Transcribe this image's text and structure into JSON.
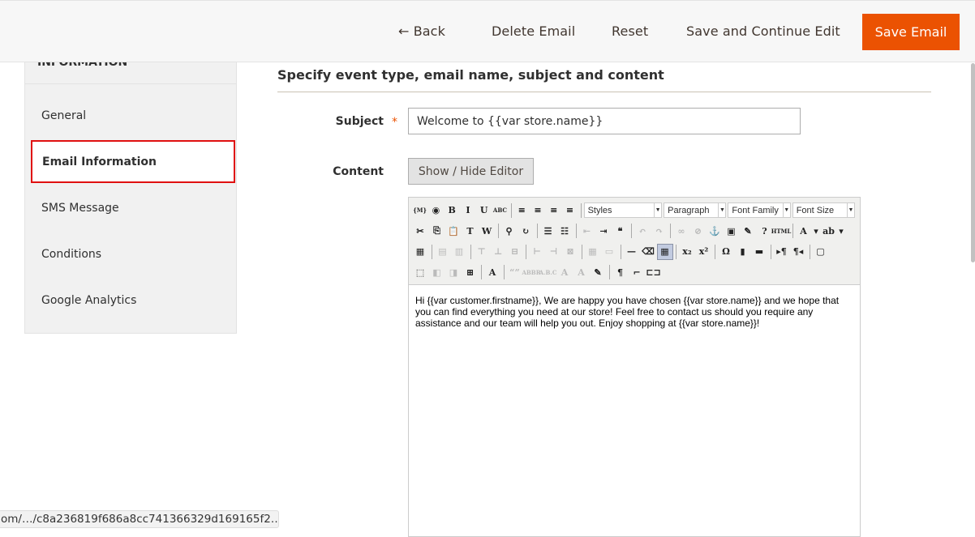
{
  "header": {
    "back": "← Back",
    "delete": "Delete Email",
    "reset": "Reset",
    "save_continue": "Save and Continue Edit",
    "save": "Save Email",
    "accent": "#eb5202"
  },
  "sidebar": {
    "title": "INFORMATION",
    "items": [
      {
        "label": "General"
      },
      {
        "label": "Email Information",
        "active": true
      },
      {
        "label": "SMS Message"
      },
      {
        "label": "Conditions"
      },
      {
        "label": "Google Analytics"
      }
    ]
  },
  "main": {
    "section_title": "Specify event type, email name, subject and content",
    "subject_label": "Subject",
    "required_mark": "*",
    "subject_value": "Welcome to {{var store.name}}",
    "content_label": "Content",
    "toggle_editor": "Show / Hide Editor",
    "editor": {
      "selects": {
        "styles": "Styles",
        "paragraph": "Paragraph",
        "font_family": "Font Family",
        "font_size": "Font Size"
      },
      "rows": [
        [
          [
            "magento-widget-icon",
            "{M}"
          ],
          [
            "magento-variable-icon",
            "◉"
          ],
          [
            "bold-icon",
            "B"
          ],
          [
            "italic-icon",
            "I"
          ],
          [
            "underline-icon",
            "U"
          ],
          [
            "strikethrough-icon",
            "ABC"
          ],
          "|",
          [
            "align-left-icon",
            "≡"
          ],
          [
            "align-center-icon",
            "≡"
          ],
          [
            "align-right-icon",
            "≡"
          ],
          [
            "align-justify-icon",
            "≡"
          ],
          "|",
          "SELECTS"
        ],
        [
          [
            "cut-icon",
            "✂"
          ],
          [
            "copy-icon",
            "⎘"
          ],
          [
            "paste-icon",
            "📋"
          ],
          [
            "paste-text-icon",
            "T"
          ],
          [
            "paste-word-icon",
            "W"
          ],
          "|",
          [
            "find-icon",
            "⚲"
          ],
          [
            "replace-icon",
            "↻"
          ],
          "|",
          [
            "bullet-list-icon",
            "☰"
          ],
          [
            "numbered-list-icon",
            "☷"
          ],
          "|",
          [
            "outdent-icon",
            "⇤",
            1
          ],
          [
            "indent-icon",
            "⇥"
          ],
          [
            "blockquote-icon",
            "❝"
          ],
          "|",
          [
            "undo-icon",
            "↶",
            1
          ],
          [
            "redo-icon",
            "↷",
            1
          ],
          "|",
          [
            "link-icon",
            "∞",
            1
          ],
          [
            "unlink-icon",
            "⊘",
            1
          ],
          [
            "anchor-icon",
            "⚓"
          ],
          [
            "image-icon",
            "▣"
          ],
          [
            "cleanup-icon",
            "✎"
          ],
          [
            "help-icon",
            "?"
          ],
          [
            "html-icon",
            "HTML"
          ],
          "|",
          [
            "text-color-icon",
            "A"
          ],
          [
            "dropdown-icon",
            "▾"
          ],
          [
            "highlight-color-icon",
            "ab"
          ],
          [
            "dropdown-icon",
            "▾"
          ]
        ],
        [
          [
            "edit-table-icon",
            "▦"
          ],
          "|",
          [
            "row-props-icon",
            "▤",
            1
          ],
          [
            "cell-props-icon",
            "▥",
            1
          ],
          "|",
          [
            "insert-row-before-icon",
            "⊤",
            1
          ],
          [
            "insert-row-after-icon",
            "⊥",
            1
          ],
          [
            "delete-row-icon",
            "⊟",
            1
          ],
          "|",
          [
            "insert-col-before-icon",
            "⊢",
            1
          ],
          [
            "insert-col-after-icon",
            "⊣",
            1
          ],
          [
            "delete-col-icon",
            "⊠",
            1
          ],
          "|",
          [
            "split-cells-icon",
            "▦",
            1
          ],
          [
            "merge-cells-icon",
            "▭",
            1
          ],
          "|",
          [
            "horizontal-rule-icon",
            "—"
          ],
          [
            "remove-format-icon",
            "⌫"
          ],
          [
            "visual-aid-icon",
            "▦",
            "on"
          ],
          "|",
          [
            "subscript-icon",
            "x₂"
          ],
          [
            "superscript-icon",
            "x²"
          ],
          "|",
          [
            "special-char-icon",
            "Ω"
          ],
          [
            "media-icon",
            "▮"
          ],
          [
            "advanced-hr-icon",
            "▬"
          ],
          "|",
          [
            "ltr-icon",
            "▸¶"
          ],
          [
            "rtl-icon",
            "¶◂"
          ],
          "|",
          [
            "fullscreen-icon",
            "▢"
          ]
        ],
        [
          [
            "insert-layer-icon",
            "⬚"
          ],
          [
            "move-forward-icon",
            "◧",
            1
          ],
          [
            "move-backward-icon",
            "◨",
            1
          ],
          [
            "absolute-icon",
            "⊞"
          ],
          "|",
          [
            "styleprops-icon",
            "A"
          ],
          "|",
          [
            "cite-icon",
            "“”",
            1
          ],
          [
            "abbr-icon",
            "ABBR",
            1
          ],
          [
            "acronym-icon",
            "A.B.C",
            1
          ],
          [
            "del-icon",
            "A",
            1
          ],
          [
            "ins-icon",
            "A",
            1
          ],
          [
            "attribs-icon",
            "✎"
          ],
          "|",
          [
            "show-blocks-icon",
            "¶"
          ],
          [
            "nonbreaking-icon",
            "⌐"
          ],
          [
            "pagebreak-icon",
            "⊏⊐"
          ]
        ]
      ],
      "body": "Hi {{var customer.firstname}}, We are happy you have chosen {{var store.name}} and we hope that you can find everything you need at our store! Feel free to contact us should you require any assistance and our team will help you out. Enjoy shopping at {{var store.name}}!"
    }
  },
  "status_bar": "om/…/c8a236819f686a8cc741366329d169165f2…"
}
